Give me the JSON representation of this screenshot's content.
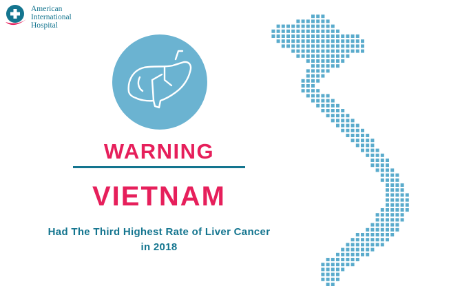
{
  "logo": {
    "line1": "American",
    "line2": "International",
    "line3": "Hospital"
  },
  "headline": {
    "warning": "WARNING",
    "country": "VIETNAM"
  },
  "subtitle": {
    "line1": "Had The Third Highest Rate of Liver Cancer",
    "line2": "in 2018"
  },
  "colors": {
    "accent_pink": "#e61f5b",
    "teal": "#14758f",
    "circle_blue": "#6bb3d1",
    "map_blue": "#5aabcc"
  },
  "icons": {
    "logo": "hospital-cross-icon",
    "organ": "liver-icon",
    "map": "vietnam-dot-map"
  }
}
